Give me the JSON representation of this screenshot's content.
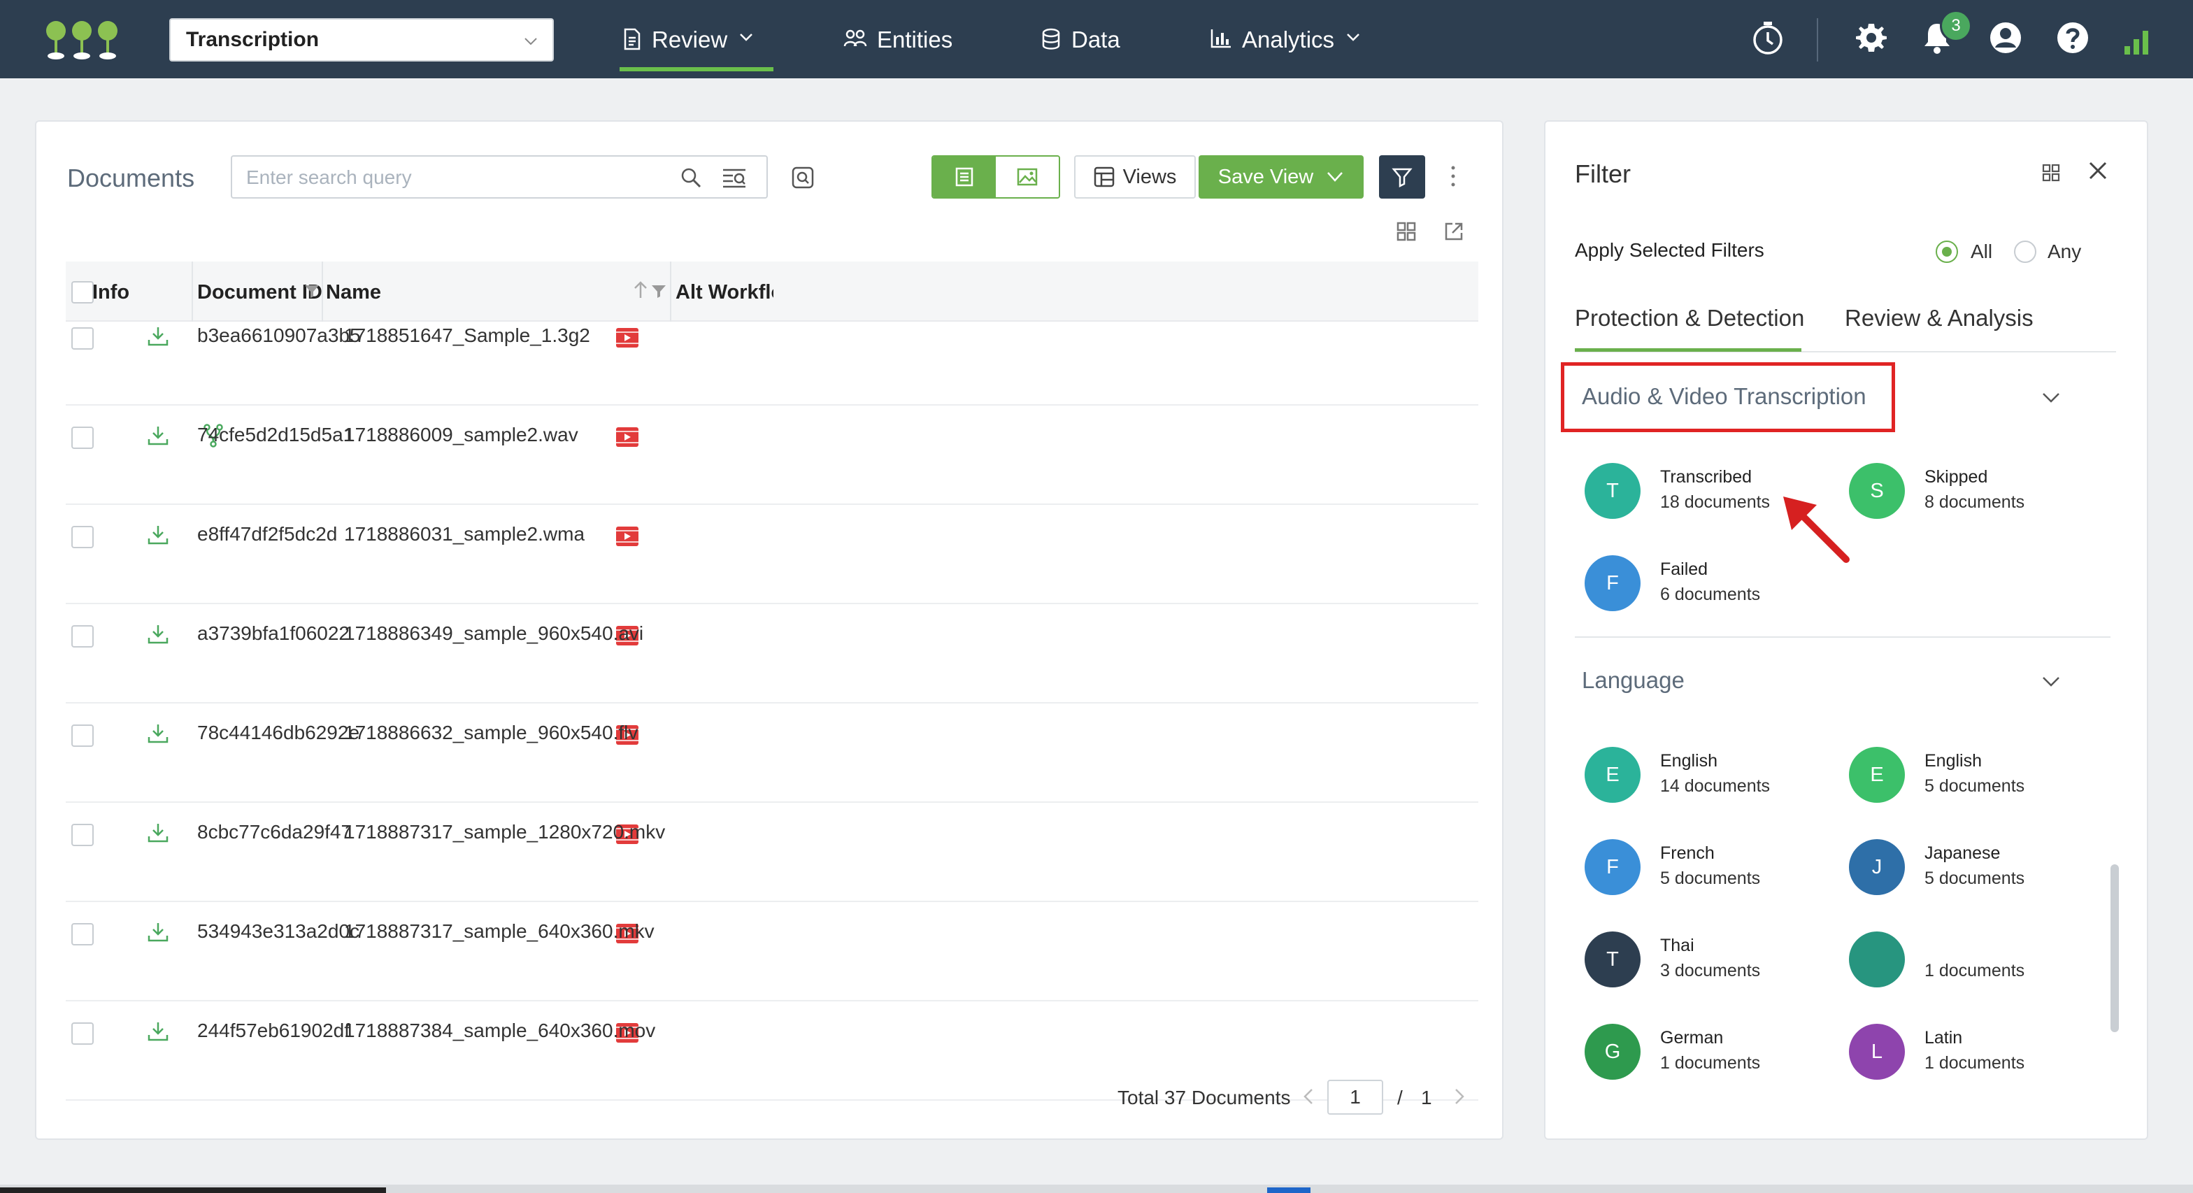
{
  "topnav": {
    "selector_value": "Transcription",
    "nav": [
      {
        "label": "Review",
        "icon": "document-icon",
        "active": true
      },
      {
        "label": "Entities",
        "icon": "entities-icon"
      },
      {
        "label": "Data",
        "icon": "database-icon"
      },
      {
        "label": "Analytics",
        "icon": "bar-chart-icon"
      }
    ],
    "notification_count": "3",
    "colors": {
      "bg": "#2d3e50",
      "accent": "#6abf4b"
    }
  },
  "documents": {
    "title": "Documents",
    "search_placeholder": "Enter search query",
    "views_label": "Views",
    "save_view_label": "Save View",
    "columns": [
      "Info",
      "Document ID",
      "Name",
      "Alt Workflow Reviewe"
    ],
    "rows": [
      {
        "id": "b3ea6610907a3b5",
        "name": "1718851647_Sample_1.3g2",
        "fork": false
      },
      {
        "id": "74cfe5d2d15d5a1",
        "name": "1718886009_sample2.wav",
        "fork": true
      },
      {
        "id": "e8ff47df2f5dc2d",
        "name": "1718886031_sample2.wma",
        "fork": false
      },
      {
        "id": "a3739bfa1f06022",
        "name": "1718886349_sample_960x540.avi",
        "fork": false
      },
      {
        "id": "78c44146db6292e",
        "name": "1718886632_sample_960x540.flv",
        "fork": false
      },
      {
        "id": "8cbc77c6da29f47",
        "name": "1718887317_sample_1280x720.mkv",
        "fork": false
      },
      {
        "id": "534943e313a2d0c",
        "name": "1718887317_sample_640x360.mkv",
        "fork": false
      },
      {
        "id": "244f57eb61902df",
        "name": "1718887384_sample_640x360.mov",
        "fork": false
      }
    ],
    "pager": {
      "total": "Total 37 Documents",
      "page": "1",
      "sep": "/",
      "pages": "1"
    }
  },
  "filter": {
    "title": "Filter",
    "apply_label": "Apply Selected Filters",
    "radio_all": "All",
    "radio_any": "Any",
    "tabs": [
      "Protection & Detection",
      "Review & Analysis"
    ],
    "sections": [
      {
        "title": "Audio & Video Transcription",
        "items": [
          {
            "initial": "T",
            "label": "Transcribed",
            "count": "18 documents",
            "color": "#2bb39a"
          },
          {
            "initial": "S",
            "label": "Skipped",
            "count": "8 documents",
            "color": "#3cc06a"
          },
          {
            "initial": "F",
            "label": "Failed",
            "count": "6 documents",
            "color": "#3a8fd8"
          }
        ]
      },
      {
        "title": "Language",
        "items": [
          {
            "initial": "E",
            "label": "English",
            "count": "14 documents",
            "color": "#2bb39a"
          },
          {
            "initial": "E",
            "label": "English",
            "count": "5 documents",
            "color": "#3cc06a"
          },
          {
            "initial": "F",
            "label": "French",
            "count": "5 documents",
            "color": "#3a8fd8"
          },
          {
            "initial": "J",
            "label": "Japanese",
            "count": "5 documents",
            "color": "#2e6fa8"
          },
          {
            "initial": "T",
            "label": "Thai",
            "count": "3 documents",
            "color": "#2d3e50"
          },
          {
            "initial": "",
            "label": "",
            "count": "1 documents",
            "color": "#27957f"
          },
          {
            "initial": "G",
            "label": "German",
            "count": "1 documents",
            "color": "#2e9a4e"
          },
          {
            "initial": "L",
            "label": "Latin",
            "count": "1 documents",
            "color": "#8e44ad"
          }
        ]
      }
    ]
  }
}
